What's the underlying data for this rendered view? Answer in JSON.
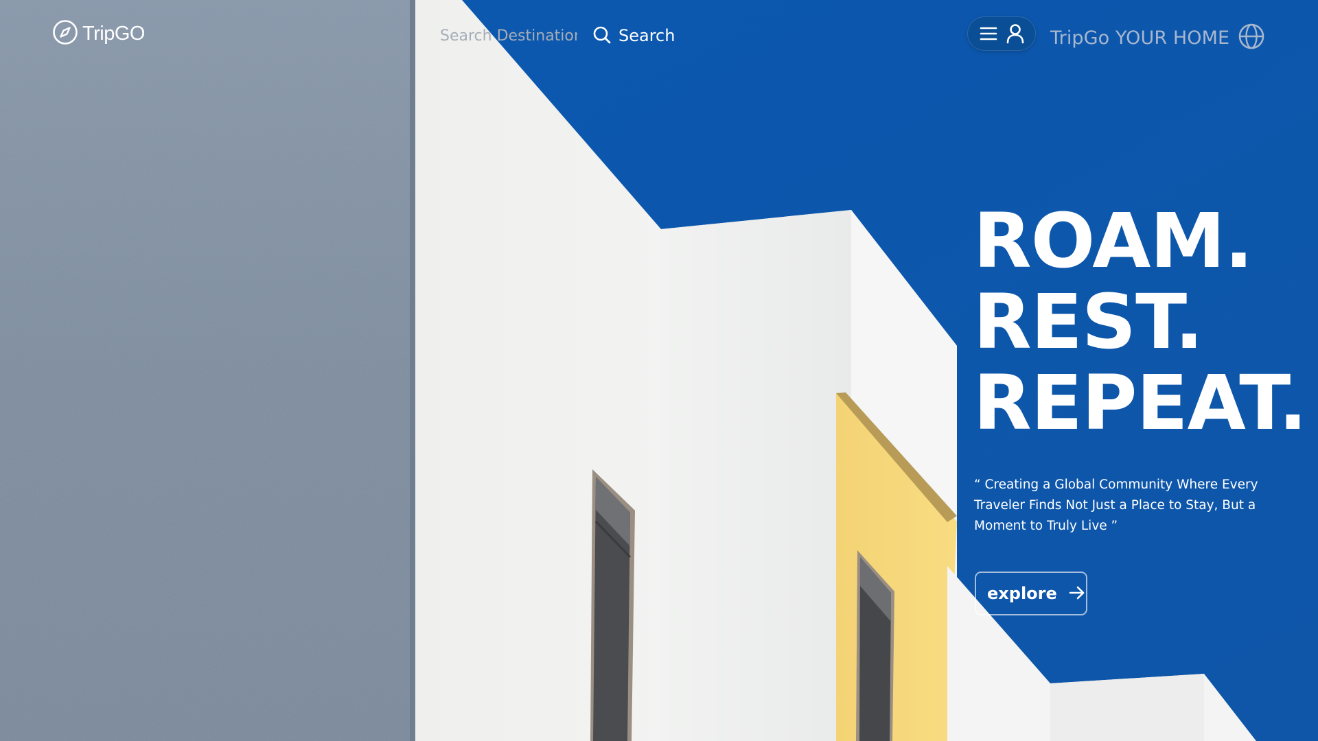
{
  "brand": {
    "name": "TripGO",
    "logo_icon": "compass-icon"
  },
  "search": {
    "placeholder": "Search Destinations",
    "button_label": "Search",
    "icon": "search-icon"
  },
  "nav": {
    "menu_icon": "hamburger-menu-icon",
    "profile_icon": "user-icon",
    "home_label": "TripGo YOUR HOME",
    "globe_icon": "globe-icon"
  },
  "hero": {
    "lines": [
      "ROAM.",
      "REST.",
      "REPEAT."
    ],
    "quote": "“ Creating a Global Community Where Every Traveler Finds Not Just a Place to Stay, But a Moment to Truly Live ”",
    "cta_label": "explore",
    "cta_icon": "arrow-right-icon"
  },
  "colors": {
    "sky_blue": "#0d57a8",
    "wall_gray": "#7f8ea0",
    "building_white": "#f4f5f4",
    "accent_yellow": "#f7d978",
    "text_white": "#ffffff"
  }
}
